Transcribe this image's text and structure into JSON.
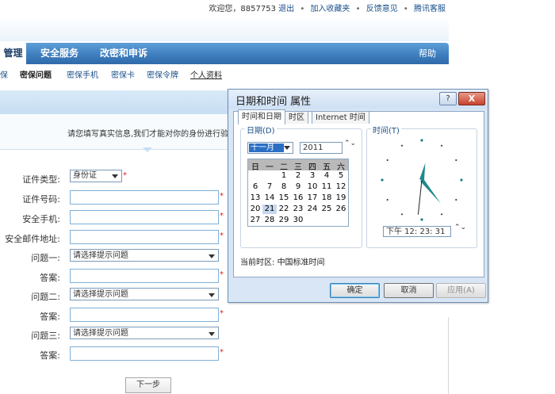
{
  "header": {
    "greeting": "欢迎您，8857753",
    "logout": "退出",
    "favorite": "加入收藏夹",
    "feedback": "反馈意见",
    "service": "腾讯客服",
    "sep": "•"
  },
  "nav": {
    "active_tab": "管理",
    "items": [
      "安全服务",
      "改密和申诉"
    ],
    "help": "帮助"
  },
  "subtabs": {
    "items": [
      "保",
      "密保问题",
      "密保手机",
      "密保卡",
      "密保令牌",
      "个人资料"
    ]
  },
  "band": {
    "text": "请您填写真实信息,我们才能对你的身份进行验证"
  },
  "form": {
    "id_type_label": "证件类型:",
    "id_type_value": "身份证",
    "id_number_label": "证件号码:",
    "mobile_label": "安全手机:",
    "email_label": "安全邮件地址:",
    "q1_label": "问题一:",
    "q2_label": "问题二:",
    "q3_label": "问题三:",
    "answer_label": "答案:",
    "question_placeholder": "请选择提示问题",
    "required": "*",
    "next_button": "下一步"
  },
  "dialog": {
    "title": "日期和时间 属性",
    "help_btn": "?",
    "close_btn": "X",
    "tabs": [
      "时间和日期",
      "时区",
      "Internet 时间"
    ],
    "date_group": "日期(D)",
    "time_group": "时间(T)",
    "month": "十一月",
    "year": "2011",
    "weekdays": [
      "日",
      "一",
      "二",
      "三",
      "四",
      "五",
      "六"
    ],
    "days": [
      [
        "",
        "",
        "1",
        "2",
        "3",
        "4",
        "5"
      ],
      [
        "6",
        "7",
        "8",
        "9",
        "10",
        "11",
        "12"
      ],
      [
        "13",
        "14",
        "15",
        "16",
        "17",
        "18",
        "19"
      ],
      [
        "20",
        "21",
        "22",
        "23",
        "24",
        "25",
        "26"
      ],
      [
        "27",
        "28",
        "29",
        "30",
        "",
        "",
        ""
      ]
    ],
    "selected_day": "21",
    "time_text": "下午   12: 23: 31",
    "timezone_label": "当前时区:",
    "timezone_value": "中国标准时间",
    "ok": "确定",
    "cancel": "取消",
    "apply": "应用(A)",
    "clock": {
      "hour": 12,
      "minute": 23,
      "second": 31
    },
    "spin_arrows": "⌃⌄"
  }
}
